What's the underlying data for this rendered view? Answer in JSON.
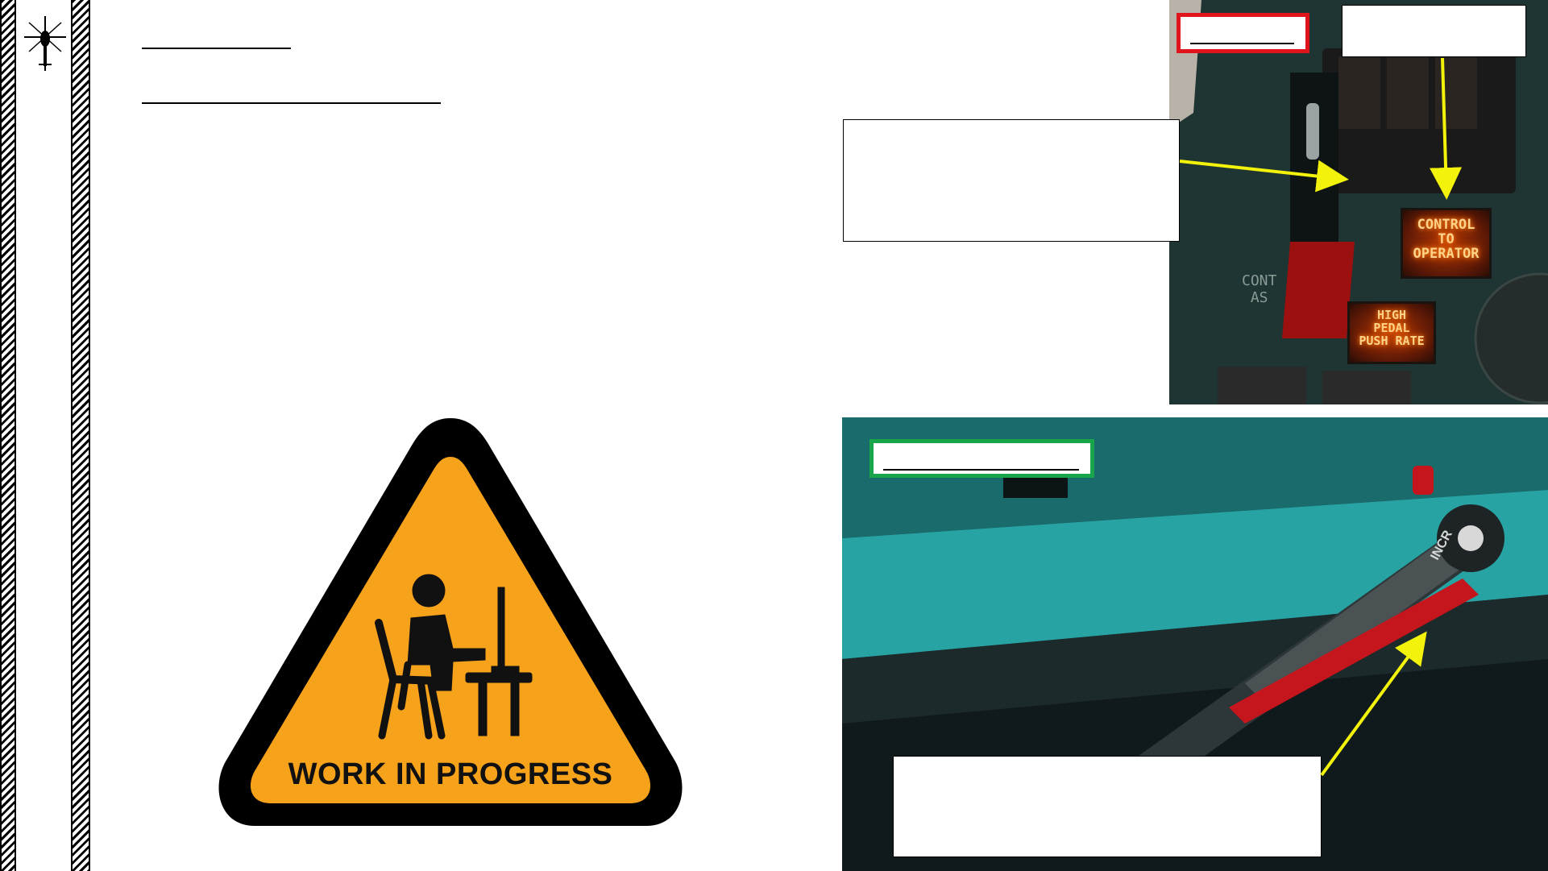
{
  "page": {
    "title": "",
    "subtitle": ""
  },
  "sign": {
    "text": "WORK IN PROGRESS",
    "fill": "#f7a21b",
    "border": "#000000"
  },
  "photo_top": {
    "lamps": [
      {
        "id": "control-to-operator",
        "text": "CONTROL\nTO\nOPERATOR"
      },
      {
        "id": "high-pedal-push-rate",
        "text": "HIGH\nPEDAL\nPUSH RATE"
      }
    ],
    "faint_label": "CONT\nAS",
    "tag_color": "#e0141c"
  },
  "photo_bottom": {
    "lever_label": "INCR",
    "tag_color": "#19a64a",
    "lever_color": "#c4161c"
  },
  "arrow_color": "#f2f20a",
  "callouts": {
    "top_left": "",
    "top_right": "",
    "bottom": ""
  }
}
